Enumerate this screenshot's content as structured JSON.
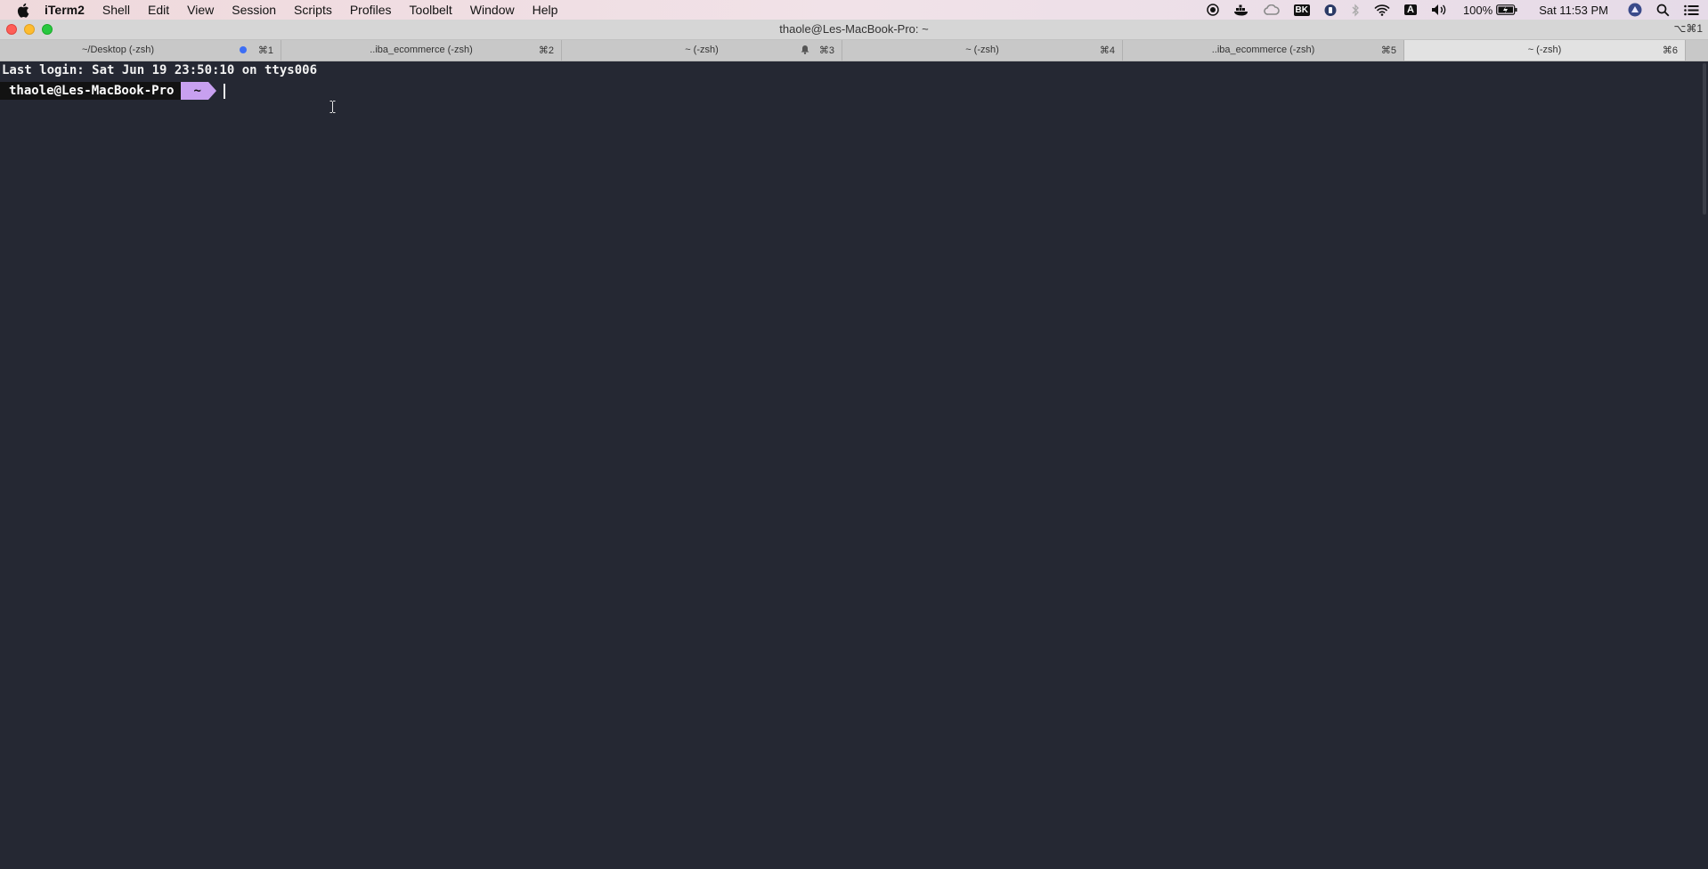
{
  "menubar": {
    "app_name": "iTerm2",
    "items": [
      "Shell",
      "Edit",
      "View",
      "Session",
      "Scripts",
      "Profiles",
      "Toolbelt",
      "Window",
      "Help"
    ],
    "status": {
      "battery_percent": "100%",
      "clock": "Sat 11:53 PM",
      "input_source": "A",
      "bk_label": "BK"
    }
  },
  "window": {
    "title": "thaole@Les-MacBook-Pro: ~",
    "shortcut": "⌥⌘1"
  },
  "tabs": [
    {
      "label": "~/Desktop (-zsh)",
      "key": "⌘1",
      "activity_dot": true
    },
    {
      "label": "..iba_ecommerce (-zsh)",
      "key": "⌘2"
    },
    {
      "label": "~ (-zsh)",
      "key": "⌘3",
      "bell": true
    },
    {
      "label": "~ (-zsh)",
      "key": "⌘4"
    },
    {
      "label": "..iba_ecommerce (-zsh)",
      "key": "⌘5"
    },
    {
      "label": "~ (-zsh)",
      "key": "⌘6",
      "active": true
    }
  ],
  "terminal": {
    "last_login": "Last login: Sat Jun 19 23:50:10 on ttys006",
    "prompt_user": "thaole@Les-MacBook-Pro",
    "prompt_dir": "~"
  },
  "colors": {
    "terminal_bg": "#252833",
    "prompt_user_bg": "#121212",
    "prompt_dir_bg": "#c8a0f0",
    "active_dot": "#3d6ef5"
  }
}
